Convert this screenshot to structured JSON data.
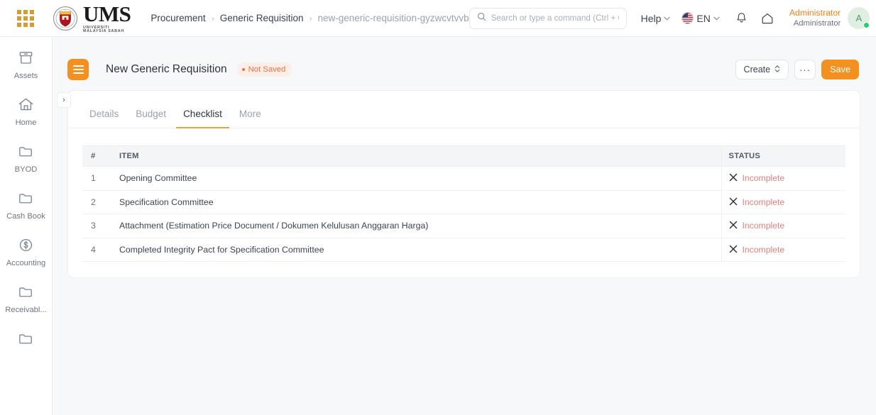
{
  "navbar": {
    "apps_icon": "apps-grid-icon",
    "logo": {
      "title": "UMS",
      "subtitle": "UNIVERSITI MALAYSIA SABAH"
    },
    "breadcrumb": [
      {
        "label": "Procurement",
        "muted": false
      },
      {
        "label": "Generic Requisition",
        "muted": false
      },
      {
        "label": "new-generic-requisition-gyzwcvtvvb",
        "muted": true
      }
    ],
    "breadcrumb_separator": "›",
    "search": {
      "placeholder": "Search or type a command (Ctrl + G)",
      "value": "",
      "icon": "search-icon"
    },
    "help": {
      "label": "Help",
      "chevron": "⌄"
    },
    "language": {
      "label": "EN",
      "chevron": "⌄",
      "flag": "us-flag-icon"
    },
    "notifications_icon": "bell-icon",
    "home_icon": "home-icon",
    "user": {
      "name": "Administrator",
      "role": "Administrator",
      "avatar_initial": "A",
      "status": "online"
    }
  },
  "sidebar": {
    "items": [
      {
        "label": "Assets",
        "icon": "archive-box-icon"
      },
      {
        "label": "Home",
        "icon": "house-icon"
      },
      {
        "label": "BYOD",
        "icon": "folder-icon"
      },
      {
        "label": "Cash Book",
        "icon": "folder-icon"
      },
      {
        "label": "Accounting",
        "icon": "dollar-circle-icon"
      },
      {
        "label": "Receivabl...",
        "icon": "folder-icon"
      },
      {
        "label": "",
        "icon": "folder-icon"
      }
    ],
    "collapse_toggle": "›"
  },
  "page": {
    "doc_icon": "document-menu-icon",
    "title": "New Generic Requisition",
    "status_badge": "Not Saved",
    "actions": {
      "create_label": "Create",
      "create_chevron": "⌃⌄",
      "more_label": "···",
      "save_label": "Save"
    }
  },
  "tabs": [
    {
      "label": "Details",
      "active": false
    },
    {
      "label": "Budget",
      "active": false
    },
    {
      "label": "Checklist",
      "active": true
    },
    {
      "label": "More",
      "active": false
    }
  ],
  "checklist": {
    "columns": {
      "num": "#",
      "item": "ITEM",
      "status": "STATUS"
    },
    "rows": [
      {
        "num": "1",
        "item": "Opening Committee",
        "status": "Incomplete",
        "status_icon": "x-icon"
      },
      {
        "num": "2",
        "item": "Specification Committee",
        "status": "Incomplete",
        "status_icon": "x-icon"
      },
      {
        "num": "3",
        "item": "Attachment (Estimation Price Document / Dokumen Kelulusan Anggaran Harga)",
        "status": "Incomplete",
        "status_icon": "x-icon"
      },
      {
        "num": "4",
        "item": "Completed Integrity Pact for Specification Committee",
        "status": "Incomplete",
        "status_icon": "x-icon"
      }
    ]
  },
  "colors": {
    "accent_orange": "#f2911f",
    "tab_underline": "#e8a33d",
    "status_incomplete": "#e08080",
    "not_saved_text": "#e8704a",
    "user_name": "#f0801a",
    "page_bg": "#f7f8fa"
  }
}
